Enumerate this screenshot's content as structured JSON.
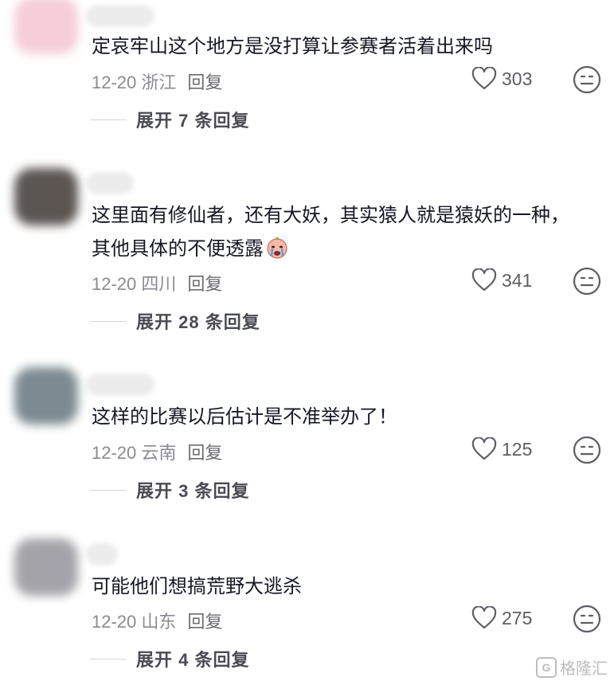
{
  "like_icon": "heart-outline-icon",
  "dislike_icon": "neutral-face-icon",
  "comments": [
    {
      "text": "定哀牢山这个地方是没打算让参赛者活着出来吗",
      "date": "12-20 浙江",
      "reply": "回复",
      "likes": "303",
      "expand": "展开 7 条回复",
      "avatar_color": "#f4c9d3"
    },
    {
      "text": "这里面有修仙者，还有大妖，其实猿人就是猿妖的一种，其他具体的不便透露",
      "emoji": "crying-face-emoji",
      "date": "12-20 四川",
      "reply": "回复",
      "likes": "341",
      "expand": "展开 28 条回复",
      "avatar_color": "#4a4440"
    },
    {
      "text": "这样的比赛以后估计是不准举办了！",
      "date": "12-20 云南",
      "reply": "回复",
      "likes": "125",
      "expand": "展开 3 条回复",
      "avatar_color": "#6e7f86"
    },
    {
      "text": "可能他们想搞荒野大逃杀",
      "date": "12-20 山东",
      "reply": "回复",
      "likes": "275",
      "expand": "展开 4 条回复",
      "avatar_color": "#9a9aa0"
    }
  ],
  "watermark": {
    "logo": "G",
    "text": "格隆汇"
  }
}
